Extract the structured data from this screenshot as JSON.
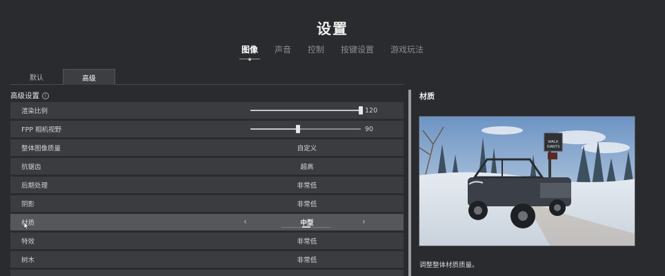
{
  "page_title": "设置",
  "main_tabs": [
    {
      "label": "图像",
      "active": true
    },
    {
      "label": "声音",
      "active": false
    },
    {
      "label": "控制",
      "active": false
    },
    {
      "label": "按键设置",
      "active": false
    },
    {
      "label": "游戏玩法",
      "active": false
    }
  ],
  "sub_tabs": [
    {
      "label": "默认",
      "active": false
    },
    {
      "label": "高级",
      "active": true
    }
  ],
  "section": {
    "title": "高级设置",
    "info_icon": "i"
  },
  "rows": {
    "render_scale": {
      "label": "渲染比例",
      "value": "120",
      "fraction": 1.0
    },
    "fpp_fov": {
      "label": "FPP 相机视野",
      "value": "90",
      "fraction": 0.43
    },
    "overall_quality": {
      "label": "整体图像质量",
      "value": "自定义"
    },
    "anti_aliasing": {
      "label": "抗锯齿",
      "value": "超高"
    },
    "post_processing": {
      "label": "后期处理",
      "value": "非常低"
    },
    "shadows": {
      "label": "阴影",
      "value": "非常低"
    },
    "textures": {
      "label": "材质",
      "value": "中型"
    },
    "effects": {
      "label": "特效",
      "value": "非常低"
    },
    "foliage": {
      "label": "树木",
      "value": "非常低"
    }
  },
  "preview": {
    "title": "材质",
    "description": "调整整体材质质量。",
    "sign_lines": [
      "WALK",
      "GIANTS"
    ]
  },
  "colors": {
    "background": "#2a2b2e",
    "row": "#3b3c3f",
    "row_highlight": "#56575a",
    "text": "#d6d6d6"
  }
}
